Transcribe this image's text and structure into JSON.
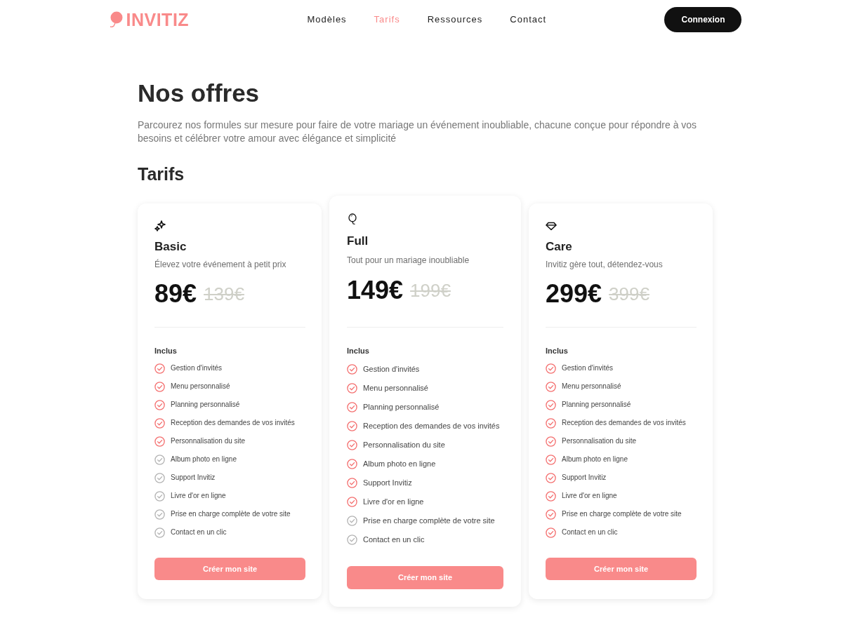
{
  "brand": {
    "name": "INVITIZ"
  },
  "nav": [
    {
      "label": "Modèles",
      "selected": false
    },
    {
      "label": "Tarifs",
      "selected": true
    },
    {
      "label": "Ressources",
      "selected": false
    },
    {
      "label": "Contact",
      "selected": false
    }
  ],
  "login_button": "Connexion",
  "heading": "Nos offres",
  "intro": "Parcourez nos formules sur mesure pour faire de votre mariage un événement inoubliable, chacune conçue pour répondre à vos besoins et célébrer votre amour avec élégance et simplicité",
  "section_title": "Tarifs",
  "plans": [
    {
      "kind": "sparkles",
      "featured": false,
      "name": "Basic",
      "tagline": "Élevez votre événement à petit prix",
      "price": "89€",
      "old_price": "139€",
      "included_label": "Inclus",
      "features": [
        {
          "label": "Gestion d'invités",
          "included": true
        },
        {
          "label": "Menu personnalisé",
          "included": true
        },
        {
          "label": "Planning personnalisé",
          "included": true
        },
        {
          "label": "Reception des demandes de vos invités",
          "included": true
        },
        {
          "label": "Personnalisation du site",
          "included": true
        },
        {
          "label": "Album photo en ligne",
          "included": false
        },
        {
          "label": "Support Invitiz",
          "included": false
        },
        {
          "label": "Livre d'or en ligne",
          "included": false
        },
        {
          "label": "Prise en charge complète de votre site",
          "included": false
        },
        {
          "label": "Contact en un clic",
          "included": false
        }
      ],
      "button": "Créer mon site"
    },
    {
      "kind": "balloon",
      "featured": true,
      "name": "Full",
      "tagline": "Tout pour un mariage inoubliable",
      "price": "149€",
      "old_price": "199€",
      "included_label": "Inclus",
      "features": [
        {
          "label": "Gestion d'invités",
          "included": true
        },
        {
          "label": "Menu personnalisé",
          "included": true
        },
        {
          "label": "Planning personnalisé",
          "included": true
        },
        {
          "label": "Reception des demandes de vos invités",
          "included": true
        },
        {
          "label": "Personnalisation du site",
          "included": true
        },
        {
          "label": "Album photo en ligne",
          "included": true
        },
        {
          "label": "Support Invitiz",
          "included": true
        },
        {
          "label": "Livre d'or en ligne",
          "included": true
        },
        {
          "label": "Prise en charge complète de votre site",
          "included": false
        },
        {
          "label": "Contact en un clic",
          "included": false
        }
      ],
      "button": "Créer mon site"
    },
    {
      "kind": "diamond",
      "featured": false,
      "name": "Care",
      "tagline": "Invitiz gère tout, détendez-vous",
      "price": "299€",
      "old_price": "399€",
      "included_label": "Inclus",
      "features": [
        {
          "label": "Gestion d'invités",
          "included": true
        },
        {
          "label": "Menu personnalisé",
          "included": true
        },
        {
          "label": "Planning personnalisé",
          "included": true
        },
        {
          "label": "Reception des demandes de vos invités",
          "included": true
        },
        {
          "label": "Personnalisation du site",
          "included": true
        },
        {
          "label": "Album photo en ligne",
          "included": true
        },
        {
          "label": "Support Invitiz",
          "included": true
        },
        {
          "label": "Livre d'or en ligne",
          "included": true
        },
        {
          "label": "Prise en charge complète de votre site",
          "included": true
        },
        {
          "label": "Contact en un clic",
          "included": true
        }
      ],
      "button": "Créer mon site"
    }
  ]
}
